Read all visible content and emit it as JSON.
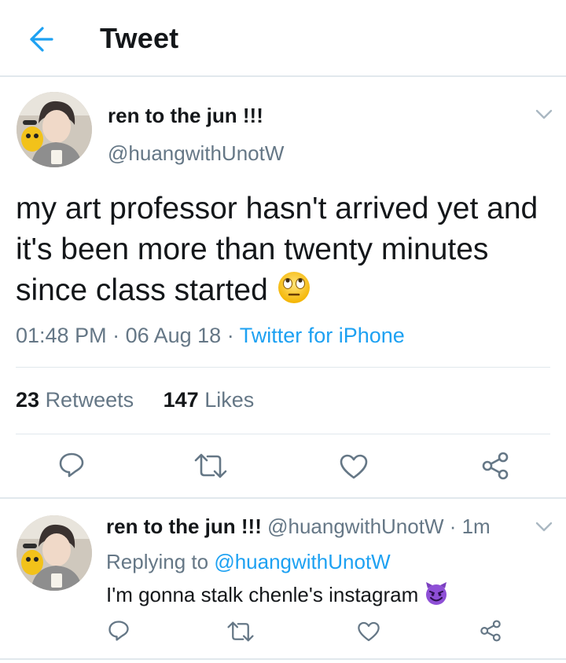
{
  "header": {
    "title": "Tweet",
    "back_icon": "arrow-left-icon",
    "accent": "#1da1f2"
  },
  "tweet": {
    "display_name": "ren to the jun !!!",
    "handle": "@huangwithUnotW",
    "text": "my art professor hasn't arrived yet and it's been more than twenty minutes since class started",
    "emoji": "face-with-rolling-eyes",
    "time": "01:48 PM",
    "date": "06 Aug 18",
    "source": "Twitter for iPhone",
    "retweets_count": "23",
    "retweets_label": "Retweets",
    "likes_count": "147",
    "likes_label": "Likes",
    "actions": [
      "reply-icon",
      "retweet-icon",
      "like-icon",
      "share-icon"
    ]
  },
  "reply": {
    "display_name": "ren to the jun !!!",
    "handle": "@huangwithUnotW",
    "time_ago": "1m",
    "replying_prefix": "Replying to",
    "replying_to": "@huangwithUnotW",
    "text": "I'm gonna stalk chenle's instagram",
    "emoji": "smiling-face-with-horns",
    "actions": [
      "reply-icon",
      "retweet-icon",
      "like-icon",
      "share-icon"
    ]
  },
  "colors": {
    "text": "#14171a",
    "muted": "#657786",
    "link": "#1da1f2",
    "border": "#e1e8ed"
  }
}
